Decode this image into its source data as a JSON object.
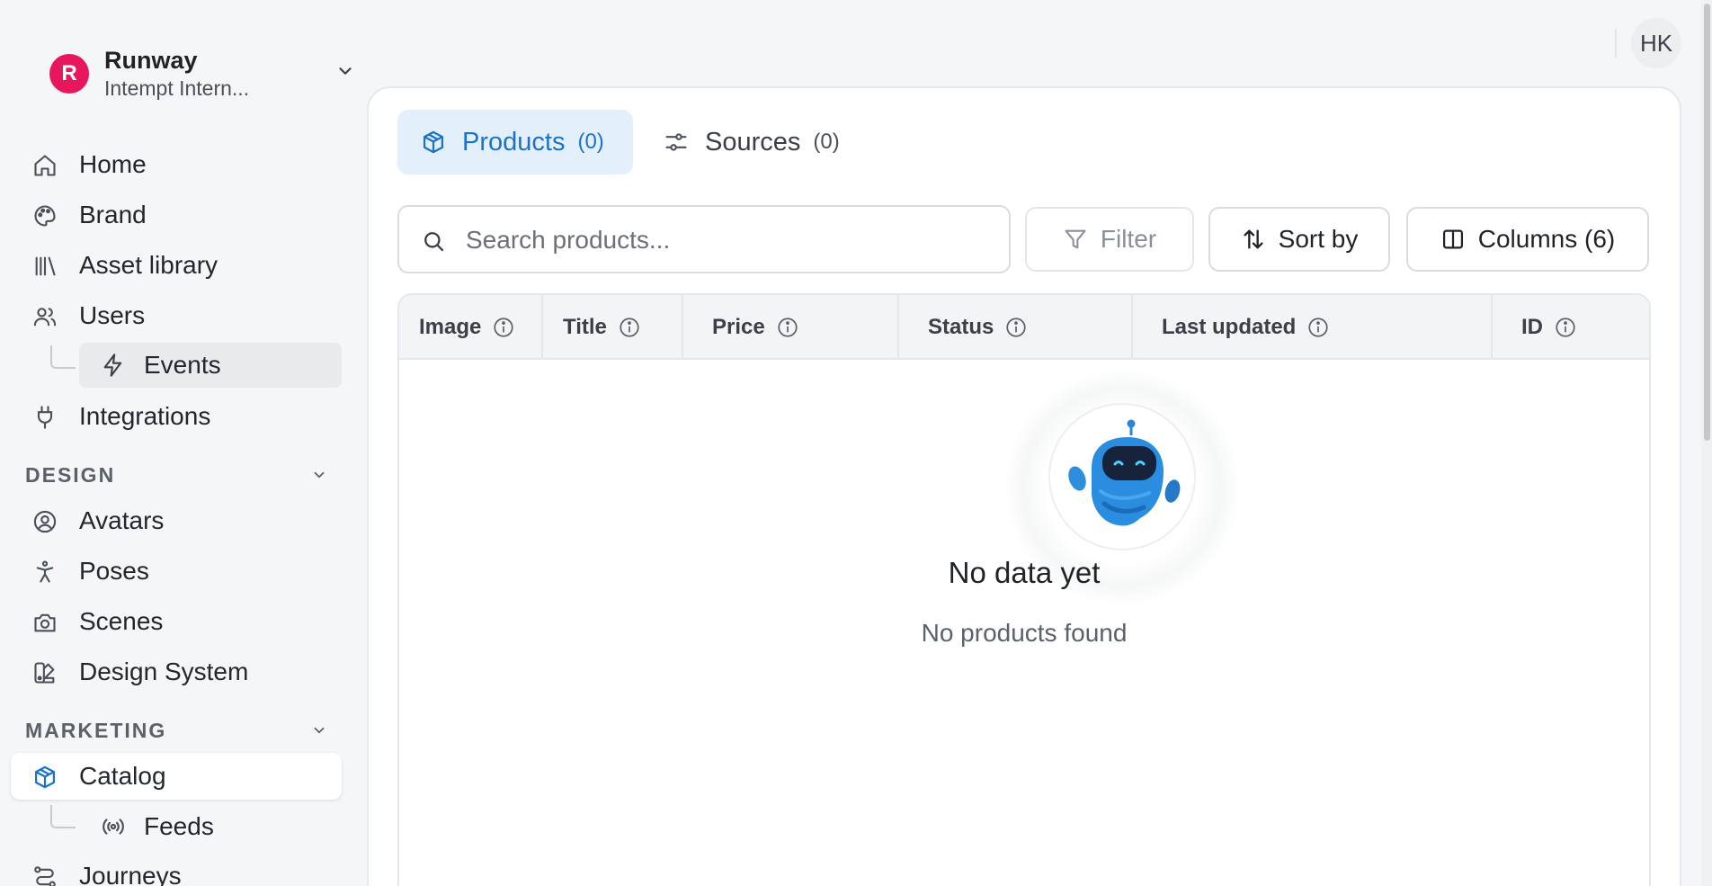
{
  "org": {
    "initial": "R",
    "name": "Runway",
    "subtitle": "Intempt Intern..."
  },
  "user": {
    "initials": "HK"
  },
  "sidebar": {
    "items": [
      {
        "label": "Home",
        "icon": "home-icon"
      },
      {
        "label": "Brand",
        "icon": "palette-icon"
      },
      {
        "label": "Asset library",
        "icon": "library-icon"
      },
      {
        "label": "Users",
        "icon": "users-icon"
      },
      {
        "label": "Integrations",
        "icon": "plug-icon"
      }
    ],
    "users_sub": {
      "label": "Events",
      "icon": "bolt-icon"
    },
    "design": {
      "heading": "DESIGN",
      "items": [
        {
          "label": "Avatars",
          "icon": "user-circle-icon"
        },
        {
          "label": "Poses",
          "icon": "person-pose-icon"
        },
        {
          "label": "Scenes",
          "icon": "camera-icon"
        },
        {
          "label": "Design System",
          "icon": "swatch-icon"
        }
      ]
    },
    "marketing": {
      "heading": "MARKETING",
      "items": [
        {
          "label": "Catalog",
          "icon": "box-icon"
        },
        {
          "label": "Journeys",
          "icon": "route-icon"
        }
      ],
      "catalog_sub": {
        "label": "Feeds",
        "icon": "broadcast-icon"
      }
    }
  },
  "tabs": [
    {
      "label": "Products",
      "count": "(0)",
      "icon": "box-icon"
    },
    {
      "label": "Sources",
      "count": "(0)",
      "icon": "sliders-icon"
    }
  ],
  "toolbar": {
    "search_placeholder": "Search products...",
    "filter_label": "Filter",
    "sort_label": "Sort by",
    "columns_label": "Columns (6)"
  },
  "table": {
    "columns": [
      "Image",
      "Title",
      "Price",
      "Status",
      "Last updated",
      "ID"
    ],
    "rows": []
  },
  "empty_state": {
    "title": "No data yet",
    "subtitle": "No products found"
  },
  "colors": {
    "accent": "#1a73c9",
    "accent_bg": "#e3f0fc",
    "org_avatar": "#e8175d"
  }
}
